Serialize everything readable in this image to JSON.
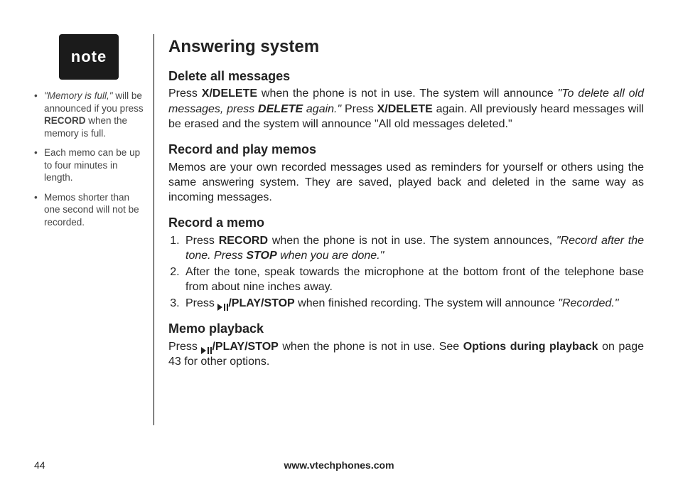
{
  "sidebar": {
    "note_label": "note",
    "items": [
      {
        "quote": "\"Memory is full,\"",
        "pre": " will be announced if you press ",
        "bold": "RECORD",
        "post": " when the memory is full."
      },
      {
        "text": "Each memo can be up to four minutes in length."
      },
      {
        "text": "Memos shorter than one second will not be recorded."
      }
    ]
  },
  "main": {
    "title": "Answering system",
    "delete_all": {
      "heading": "Delete all messages",
      "p1a": "Press ",
      "p1b": "X/DELETE",
      "p1c": " when the phone is not in use. The system will announce ",
      "p1d": "\"To delete all old messages, press ",
      "p1e": "DELETE",
      "p1f": " again.\"",
      "p1g": " Press ",
      "p1h": "X/DELETE",
      "p1i": " again. All previously heard messages will be erased and the system will announce \"All old messages deleted.\""
    },
    "record_play": {
      "heading": "Record and play memos",
      "body": "Memos are your own recorded messages used as reminders for yourself or others using the same answering system. They are saved, played back and deleted in the same way as incoming messages."
    },
    "record_memo": {
      "heading": "Record a memo",
      "step1": {
        "a": "Press ",
        "b": "RECORD",
        "c": " when the phone is not in use. The system announces, ",
        "d": "\"Record after the tone. Press ",
        "e": "STOP",
        "f": " when you are done.\""
      },
      "step2": "After the tone, speak towards the microphone at the bottom front of the telephone base from about nine inches away.",
      "step3": {
        "a": "Press ",
        "b": "/PLAY/STOP",
        "c": " when finished recording. The system will announce ",
        "d": "\"Recorded.\""
      }
    },
    "memo_playback": {
      "heading": "Memo playback",
      "a": "Press ",
      "b": "/PLAY/STOP",
      "c": " when the phone is not in use. See ",
      "d": "Options during playback",
      "e": " on page 43 for other options."
    }
  },
  "footer": {
    "page": "44",
    "url": "www.vtechphones.com"
  }
}
